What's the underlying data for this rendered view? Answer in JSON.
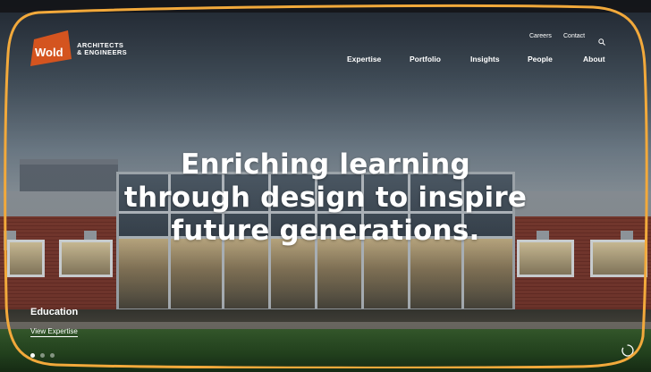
{
  "brand": {
    "logo_word": "Wold",
    "tagline_line1": "ARCHITECTS",
    "tagline_line2": "& ENGINEERS",
    "color": "#d4541f"
  },
  "utility_nav": {
    "careers": "Careers",
    "contact": "Contact",
    "search_icon": "search-icon"
  },
  "main_nav": {
    "items": [
      {
        "label": "Expertise"
      },
      {
        "label": "Portfolio"
      },
      {
        "label": "Insights"
      },
      {
        "label": "People"
      },
      {
        "label": "About"
      }
    ]
  },
  "hero": {
    "headline_line1": "Enriching learning",
    "headline_line2": "through design to inspire",
    "headline_line3": "future generations.",
    "category": "Education",
    "cta": "View Expertise"
  },
  "carousel": {
    "slide_count": 3,
    "active_index": 0,
    "loader_icon": "spinner-icon"
  },
  "colors": {
    "highlight_outline": "#f2a93b",
    "text": "#ffffff"
  }
}
